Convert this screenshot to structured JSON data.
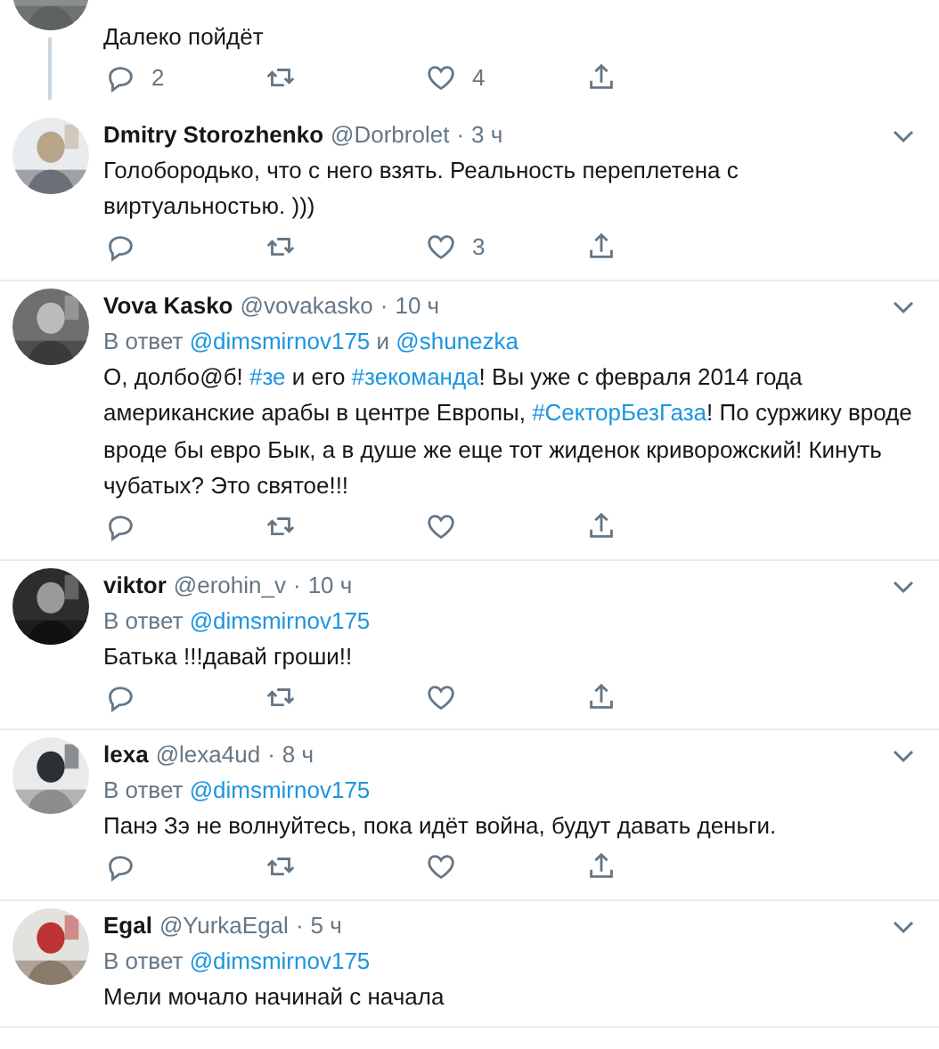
{
  "tweets": [
    {
      "connected": true,
      "actions_bar": true,
      "body": [
        {
          "kind": "text",
          "text": "Далеко пойдёт"
        }
      ],
      "counts": {
        "replies": "2",
        "likes": "4"
      }
    },
    {
      "connected": false,
      "actions_bar": true,
      "name": "Dmitry Storozhenko",
      "handle": "@Dorbrolet",
      "dot": "·",
      "time": "3 ч",
      "body": [
        {
          "kind": "text",
          "text": "Голобородько, что с него взять. Реальность переплетена с виртуальностью. )))"
        }
      ],
      "counts": {
        "likes": "3"
      }
    },
    {
      "connected": false,
      "actions_bar": true,
      "name": "Vova Kasko",
      "handle": "@vovakasko",
      "dot": "·",
      "time": "10 ч",
      "reply": {
        "prefix": "В ответ",
        "mentions": [
          "@dimsmirnov175",
          "@shunezka"
        ],
        "joiner": "и"
      },
      "body": [
        {
          "kind": "text",
          "text": "О, долбо@б! "
        },
        {
          "kind": "hashtag",
          "text": "#зе"
        },
        {
          "kind": "text",
          "text": " и его "
        },
        {
          "kind": "hashtag",
          "text": "#зекоманда"
        },
        {
          "kind": "text",
          "text": "! Вы уже с февраля 2014 года американские арабы в центре Европы, "
        },
        {
          "kind": "hashtag",
          "text": "#СекторБезГаза"
        },
        {
          "kind": "text",
          "text": "! По суржику вроде вроде бы евро Бык, а в душе же еще тот жиденок криворожский! Кинуть чубатых? Это святое!!!"
        }
      ]
    },
    {
      "connected": false,
      "actions_bar": true,
      "name": "viktor",
      "handle": "@erohin_v",
      "dot": "·",
      "time": "10 ч",
      "reply": {
        "prefix": "В ответ",
        "mentions": [
          "@dimsmirnov175"
        ]
      },
      "body": [
        {
          "kind": "text",
          "text": "Батька !!!давай гроши!!"
        }
      ]
    },
    {
      "connected": false,
      "actions_bar": true,
      "name": "lexa",
      "handle": "@lexa4ud",
      "dot": "·",
      "time": "8 ч",
      "reply": {
        "prefix": "В ответ",
        "mentions": [
          "@dimsmirnov175"
        ]
      },
      "body": [
        {
          "kind": "text",
          "text": "Панэ Зэ не волнуйтесь, пока идёт война, будут давать деньги."
        }
      ]
    },
    {
      "connected": false,
      "actions_bar": false,
      "name": "Egal",
      "handle": "@YurkaEgal",
      "dot": "·",
      "time": "5 ч",
      "reply": {
        "prefix": "В ответ",
        "mentions": [
          "@dimsmirnov175"
        ]
      },
      "body": [
        {
          "kind": "text",
          "text": "Мели мочало начинай с начала"
        }
      ]
    }
  ]
}
